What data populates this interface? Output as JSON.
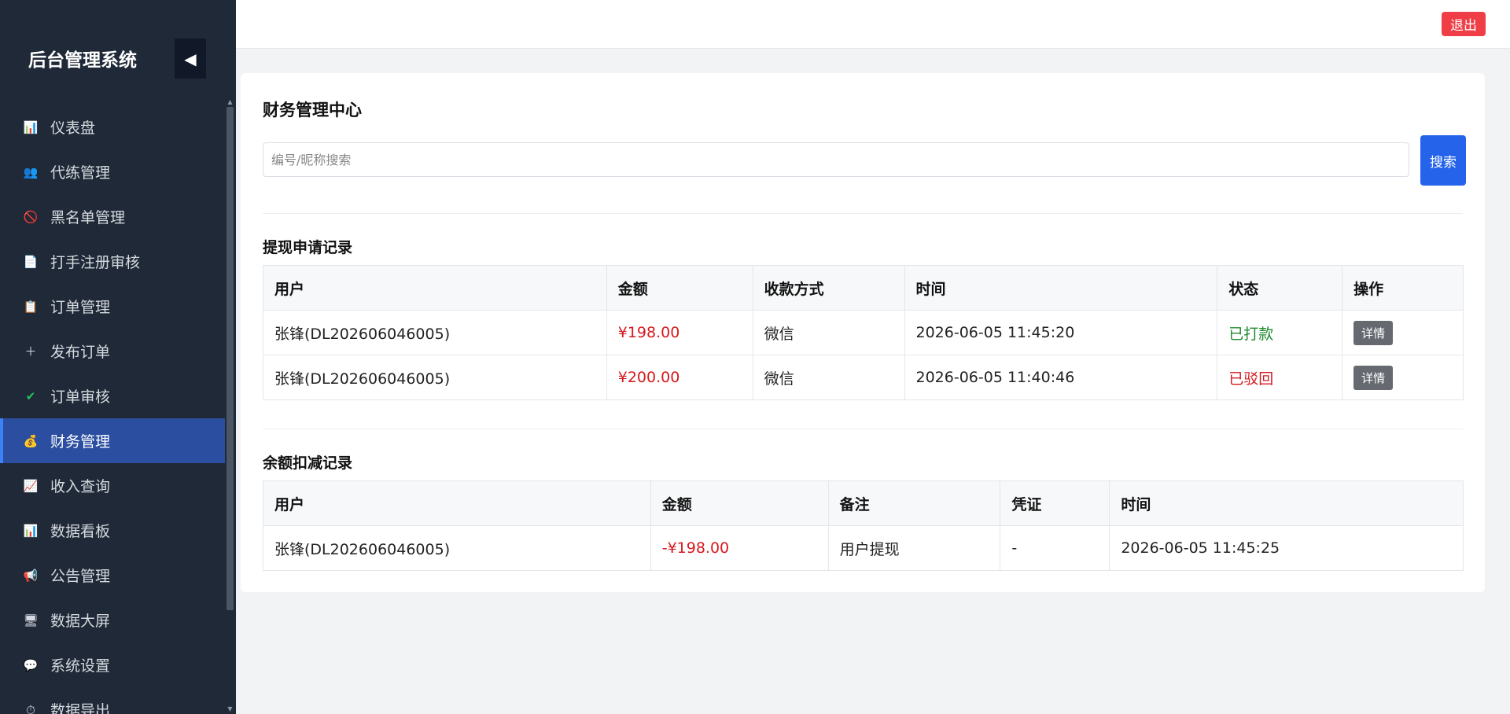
{
  "sidebar": {
    "brand": "后台管理系统",
    "collapse_icon": "◀",
    "items": [
      {
        "label": "仪表盘",
        "icon": "📊"
      },
      {
        "label": "代练管理",
        "icon": "👥"
      },
      {
        "label": "黑名单管理",
        "icon": "🚫"
      },
      {
        "label": "打手注册审核",
        "icon": "📄"
      },
      {
        "label": "订单管理",
        "icon": "📋"
      },
      {
        "label": "发布订单",
        "icon": "＋"
      },
      {
        "label": "订单审核",
        "icon": "✔"
      },
      {
        "label": "财务管理",
        "icon": "💰",
        "active": true
      },
      {
        "label": "收入查询",
        "icon": "📈"
      },
      {
        "label": "数据看板",
        "icon": "📊"
      },
      {
        "label": "公告管理",
        "icon": "📢"
      },
      {
        "label": "数据大屏",
        "icon": "🖥"
      },
      {
        "label": "系统设置",
        "icon": "💬"
      },
      {
        "label": "数据导出",
        "icon": "⏱"
      }
    ]
  },
  "topbar": {
    "logout_label": "退出"
  },
  "main": {
    "title": "财务管理中心",
    "search": {
      "placeholder": "编号/昵称搜索",
      "value": "",
      "button_label": "搜索"
    },
    "withdraw": {
      "title": "提现申请记录",
      "columns": [
        "用户",
        "金额",
        "收款方式",
        "时间",
        "状态",
        "操作"
      ],
      "rows": [
        {
          "user": "张锋(DL202606046005)",
          "amount": "¥198.00",
          "method": "微信",
          "time": "2026-06-05 11:45:20",
          "status": "已打款",
          "action": "详情"
        },
        {
          "user": "张锋(DL202606046005)",
          "amount": "¥200.00",
          "method": "微信",
          "time": "2026-06-05 11:40:46",
          "status": "已驳回",
          "action": "详情"
        }
      ]
    },
    "deduction": {
      "title": "余额扣减记录",
      "columns": [
        "用户",
        "金额",
        "备注",
        "凭证",
        "时间"
      ],
      "rows": [
        {
          "user": "张锋(DL202606046005)",
          "amount": "-¥198.00",
          "note": "用户提现",
          "voucher": "-",
          "time": "2026-06-05 11:45:25"
        }
      ]
    }
  },
  "colors": {
    "sidebar_bg": "#1f2937",
    "active_item": "#2b4ea0",
    "primary": "#2563eb",
    "danger": "#ef3e46",
    "amount_red": "#d6191e",
    "success_green": "#1c8a2e"
  }
}
